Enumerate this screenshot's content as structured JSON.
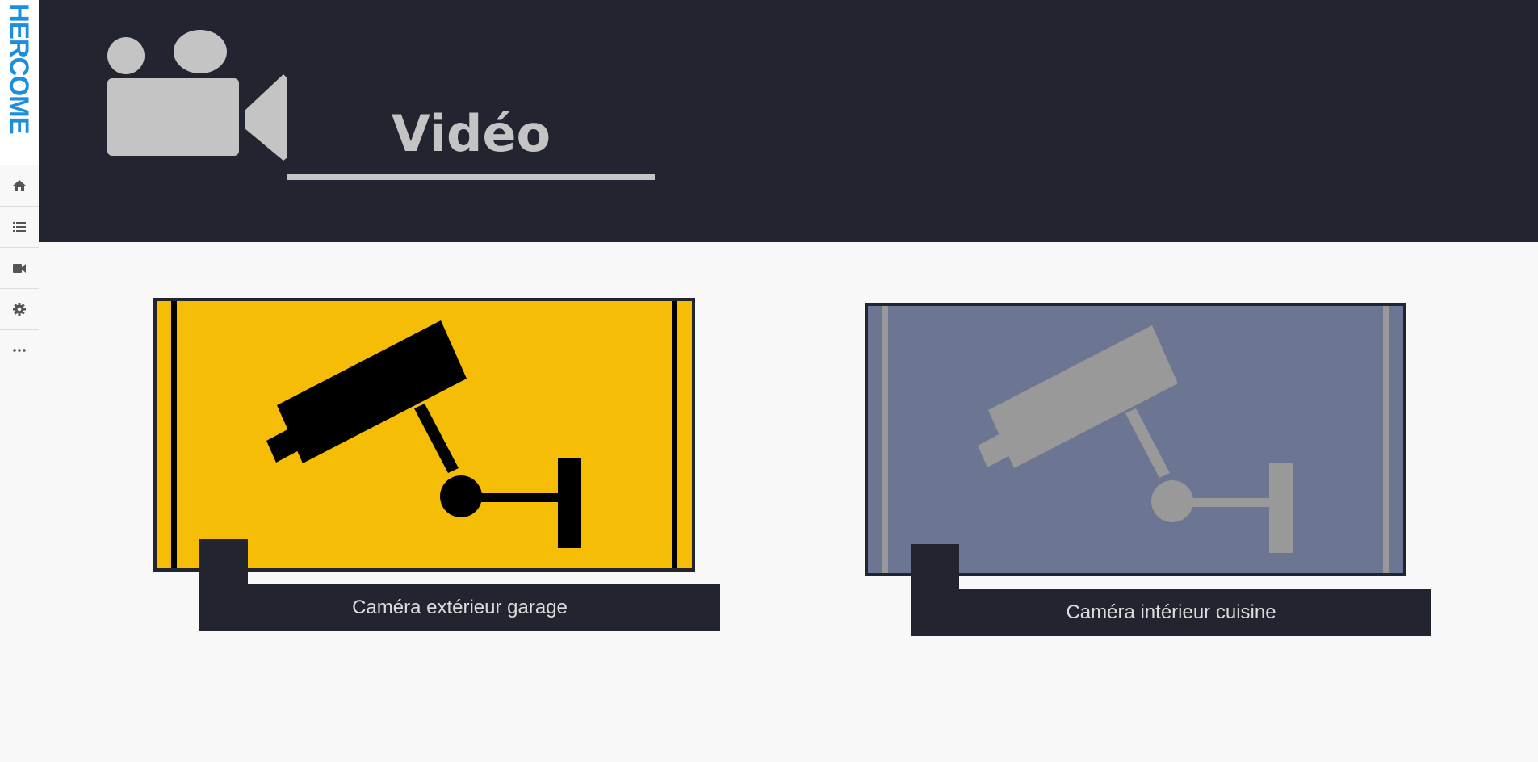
{
  "brand": {
    "logo_text": "HERCOME",
    "color": "#1c8ee0"
  },
  "sidebar": {
    "items": [
      {
        "icon": "home-icon"
      },
      {
        "icon": "list-icon"
      },
      {
        "icon": "video-camera-icon"
      },
      {
        "icon": "gear-icon"
      },
      {
        "icon": "more-icon"
      }
    ]
  },
  "header": {
    "icon": "video-camera-icon",
    "title": "Vidéo",
    "background": "#22252f",
    "text_color": "#c4c4c4"
  },
  "cameras": [
    {
      "label": "Caméra extérieur garage",
      "icon": "security-camera-icon",
      "background": "#f5bd05",
      "foreground": "#000000",
      "active": true
    },
    {
      "label": "Caméra intérieur cuisine",
      "icon": "security-camera-icon",
      "background": "#6c7592",
      "foreground": "#999999",
      "active": false
    }
  ]
}
